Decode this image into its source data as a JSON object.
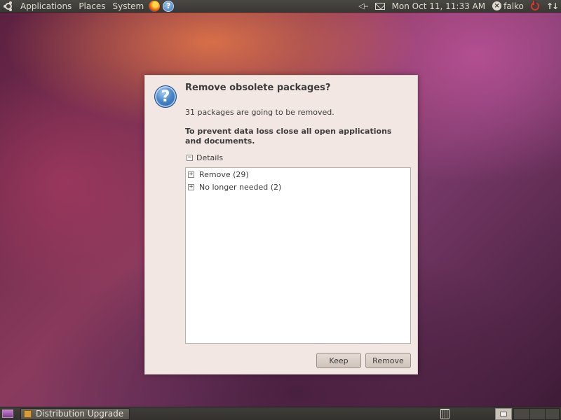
{
  "top_panel": {
    "menus": [
      "Applications",
      "Places",
      "System"
    ],
    "clock": "Mon Oct 11, 11:33 AM",
    "user": "falko",
    "icons": [
      "ubuntu-logo-icon",
      "firefox-icon",
      "help-icon",
      "volume-icon",
      "mail-icon",
      "user-icon",
      "power-icon",
      "network-icon"
    ]
  },
  "dialog": {
    "title": "Remove obsolete packages?",
    "message": "31 packages are going to be removed.",
    "warning": "To prevent data loss close all open applications and documents.",
    "details_label": "Details",
    "details_expanded_glyph": "−",
    "tree": [
      {
        "glyph": "+",
        "label": "Remove (29)"
      },
      {
        "glyph": "+",
        "label": "No longer needed (2)"
      }
    ],
    "buttons": {
      "keep": "Keep",
      "remove": "Remove"
    },
    "icon": "question-icon"
  },
  "bottom_panel": {
    "task": "Distribution Upgrade",
    "icons": [
      "show-desktop-icon",
      "trash-icon",
      "workspace-switcher"
    ]
  },
  "colors": {
    "dialog_bg": "#f2e7e3",
    "panel_bg": "#3a3834",
    "accent": "#4a86c8"
  }
}
